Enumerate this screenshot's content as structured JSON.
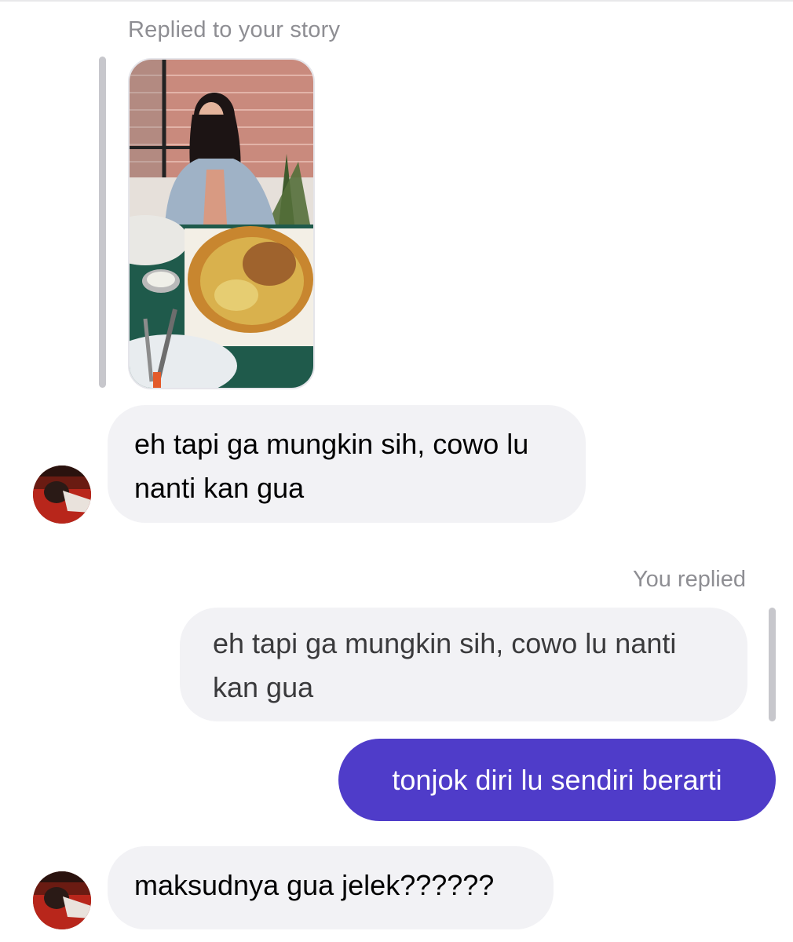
{
  "conversation": {
    "story_reply_caption": "Replied to your story",
    "messages": [
      {
        "sender": "them",
        "text": "eh tapi ga mungkin sih, cowo lu nanti kan gua"
      },
      {
        "sender": "me",
        "reply_label": "You replied",
        "quoted_text": "eh tapi ga mungkin sih, cowo lu nanti kan gua",
        "text": "tonjok diri lu sendiri berarti"
      },
      {
        "sender": "them",
        "text": "maksudnya gua jelek??????"
      }
    ]
  },
  "colors": {
    "outgoing_bubble": "#4f3cc9",
    "incoming_bubble": "#f2f2f5",
    "caption_gray": "#8e8e93"
  },
  "icons": {
    "story_thumbnail": "story-photo-thumbnail",
    "avatar": "contact-avatar"
  }
}
